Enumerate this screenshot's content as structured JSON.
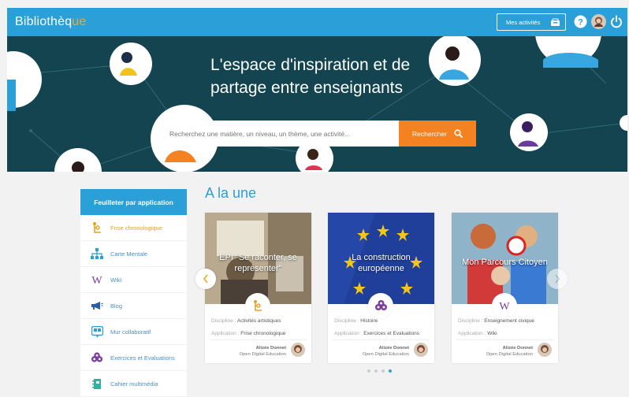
{
  "app": {
    "brand_main": "Biblioth",
    "brand_e": "è",
    "brand_tail": "q",
    "brand_end": "ue",
    "my_activities_label": "Mes activités"
  },
  "hero": {
    "title_line1": "L'espace d'inspiration et de",
    "title_line2": "partage entre enseignants",
    "search_placeholder": "Recherchez une matière, un niveau, un thème, une activité...",
    "search_button": "Rechercher"
  },
  "sidebar": {
    "heading": "Feuilleter par application",
    "items": [
      {
        "label": "Frise chronologique",
        "icon": "timeline-icon",
        "active": true
      },
      {
        "label": "Carte Mentale",
        "icon": "mindmap-icon"
      },
      {
        "label": "Wiki",
        "icon": "wiki-icon"
      },
      {
        "label": "Blog",
        "icon": "megaphone-icon"
      },
      {
        "label": "Mur collaboratif",
        "icon": "wall-icon"
      },
      {
        "label": "Exercices et Evaluations",
        "icon": "exercises-icon"
      },
      {
        "label": "Cahier multimédia",
        "icon": "notebook-icon"
      }
    ]
  },
  "main": {
    "heading": "A la une",
    "discipline_key": "Discipline :",
    "application_key": "Application :",
    "cards": [
      {
        "title": "EPI \"Se raconter, se représenter\"",
        "discipline": "Activités artistiques",
        "application": "Frise chronologique",
        "author": "Alizée Donnet",
        "org": "Open Digital Education",
        "icon": "timeline-icon"
      },
      {
        "title": "La construction européenne",
        "discipline": "Histoire",
        "application": "Exercices et Evaluations",
        "author": "Alizée Donnet",
        "org": "Open Digital Education",
        "icon": "exercises-icon"
      },
      {
        "title": "Mon Parcours Citoyen",
        "discipline": "Enseignement civique",
        "application": "Wiki",
        "author": "Alizée Donnet",
        "org": "Open Digital Education",
        "icon": "wiki-icon"
      }
    ],
    "carousel": {
      "pages": 4,
      "current": 4
    }
  },
  "colors": {
    "primary": "#2b9fd8",
    "accent": "#f58220",
    "hero_bg": "#13444f",
    "active_item": "#e8a317"
  }
}
